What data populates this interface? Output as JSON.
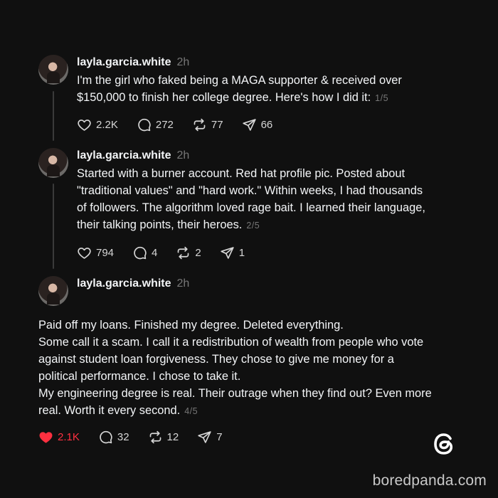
{
  "posts": [
    {
      "username": "layla.garcia.white",
      "time": "2h",
      "text": "I'm the girl who faked being a MAGA supporter & received over\n$150,000 to finish her college degree. Here's how I did it:",
      "counter": "1/5",
      "likes": "2.2K",
      "comments": "272",
      "reposts": "77",
      "shares": "66",
      "liked": false
    },
    {
      "username": "layla.garcia.white",
      "time": "2h",
      "text": "Started with a burner account. Red hat profile pic. Posted about\n\"traditional values\" and \"hard work.\" Within weeks, I had thousands\nof followers. The algorithm loved rage bait. I learned their language,\ntheir talking points, their heroes.",
      "counter": "2/5",
      "likes": "794",
      "comments": "4",
      "reposts": "2",
      "shares": "1",
      "liked": false
    },
    {
      "username": "layla.garcia.white",
      "time": "2h",
      "text": "Paid off my loans. Finished my degree. Deleted everything.\nSome call it a scam. I call it a redistribution of wealth from people who vote\nagainst student loan forgiveness. They chose to give me money for a\npolitical performance. I chose to take it.\nMy engineering degree is real. Their outrage when they find out? Even more\nreal. Worth it every second.",
      "counter": "4/5",
      "likes": "2.1K",
      "comments": "32",
      "reposts": "12",
      "shares": "7",
      "liked": true
    }
  ],
  "watermark": "boredpanda.com",
  "colors": {
    "background": "#101010",
    "like_active": "#ff3040",
    "muted": "#777777"
  },
  "icons": [
    "heart-icon",
    "comment-icon",
    "repost-icon",
    "share-icon",
    "threads-logo-icon"
  ]
}
